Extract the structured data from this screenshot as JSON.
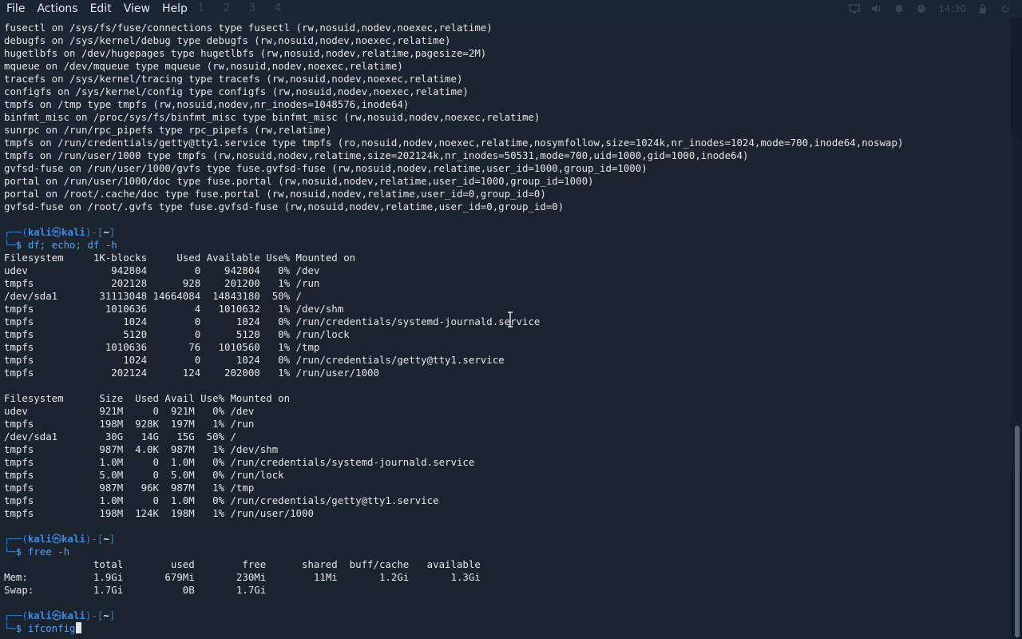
{
  "menubar": {
    "items": [
      "File",
      "Actions",
      "Edit",
      "View",
      "Help"
    ],
    "workspaces": [
      "1",
      "2",
      "3",
      "4"
    ],
    "clock": "14:30"
  },
  "prompt": {
    "user": "kali",
    "at": "㉿",
    "host": "kali",
    "dir": "~",
    "top_left": "┌──(",
    "mid": ")-[",
    "close": "]",
    "bottom_left": "└─",
    "dollar": "$ "
  },
  "mount_output": [
    "fusectl on /sys/fs/fuse/connections type fusectl (rw,nosuid,nodev,noexec,relatime)",
    "debugfs on /sys/kernel/debug type debugfs (rw,nosuid,nodev,noexec,relatime)",
    "hugetlbfs on /dev/hugepages type hugetlbfs (rw,nosuid,nodev,relatime,pagesize=2M)",
    "mqueue on /dev/mqueue type mqueue (rw,nosuid,nodev,noexec,relatime)",
    "tracefs on /sys/kernel/tracing type tracefs (rw,nosuid,nodev,noexec,relatime)",
    "configfs on /sys/kernel/config type configfs (rw,nosuid,nodev,noexec,relatime)",
    "tmpfs on /tmp type tmpfs (rw,nosuid,nodev,nr_inodes=1048576,inode64)",
    "binfmt_misc on /proc/sys/fs/binfmt_misc type binfmt_misc (rw,nosuid,nodev,noexec,relatime)",
    "sunrpc on /run/rpc_pipefs type rpc_pipefs (rw,relatime)",
    "tmpfs on /run/credentials/getty@tty1.service type tmpfs (ro,nosuid,nodev,noexec,relatime,nosymfollow,size=1024k,nr_inodes=1024,mode=700,inode64,noswap)",
    "tmpfs on /run/user/1000 type tmpfs (rw,nosuid,nodev,relatime,size=202124k,nr_inodes=50531,mode=700,uid=1000,gid=1000,inode64)",
    "gvfsd-fuse on /run/user/1000/gvfs type fuse.gvfsd-fuse (rw,nosuid,nodev,relatime,user_id=1000,group_id=1000)",
    "portal on /run/user/1000/doc type fuse.portal (rw,nosuid,nodev,relatime,user_id=1000,group_id=1000)",
    "portal on /root/.cache/doc type fuse.portal (rw,nosuid,nodev,relatime,user_id=0,group_id=0)",
    "gvfsd-fuse on /root/.gvfs type fuse.gvfsd-fuse (rw,nosuid,nodev,relatime,user_id=0,group_id=0)"
  ],
  "cmd1": "df; echo; df -h",
  "df_output": [
    "Filesystem     1K-blocks     Used Available Use% Mounted on",
    "udev              942804        0    942804   0% /dev",
    "tmpfs             202128      928    201200   1% /run",
    "/dev/sda1       31113048 14664084  14843180  50% /",
    "tmpfs            1010636        4   1010632   1% /dev/shm",
    "tmpfs               1024        0      1024   0% /run/credentials/systemd-journald.service",
    "tmpfs               5120        0      5120   0% /run/lock",
    "tmpfs            1010636       76   1010560   1% /tmp",
    "tmpfs               1024        0      1024   0% /run/credentials/getty@tty1.service",
    "tmpfs             202124      124    202000   1% /run/user/1000"
  ],
  "dfh_output": [
    "Filesystem      Size  Used Avail Use% Mounted on",
    "udev            921M     0  921M   0% /dev",
    "tmpfs           198M  928K  197M   1% /run",
    "/dev/sda1        30G   14G   15G  50% /",
    "tmpfs           987M  4.0K  987M   1% /dev/shm",
    "tmpfs           1.0M     0  1.0M   0% /run/credentials/systemd-journald.service",
    "tmpfs           5.0M     0  5.0M   0% /run/lock",
    "tmpfs           987M   96K  987M   1% /tmp",
    "tmpfs           1.0M     0  1.0M   0% /run/credentials/getty@tty1.service",
    "tmpfs           198M  124K  198M   1% /run/user/1000"
  ],
  "cmd2": "free -h",
  "free_output": [
    "               total        used        free      shared  buff/cache   available",
    "Mem:           1.9Gi       679Mi       230Mi        11Mi       1.2Gi       1.3Gi",
    "Swap:          1.7Gi          0B       1.7Gi"
  ],
  "cmd3": "ifconfig",
  "scrollbar": {
    "position_fraction": 0.66,
    "visible_fraction": 0.34
  }
}
